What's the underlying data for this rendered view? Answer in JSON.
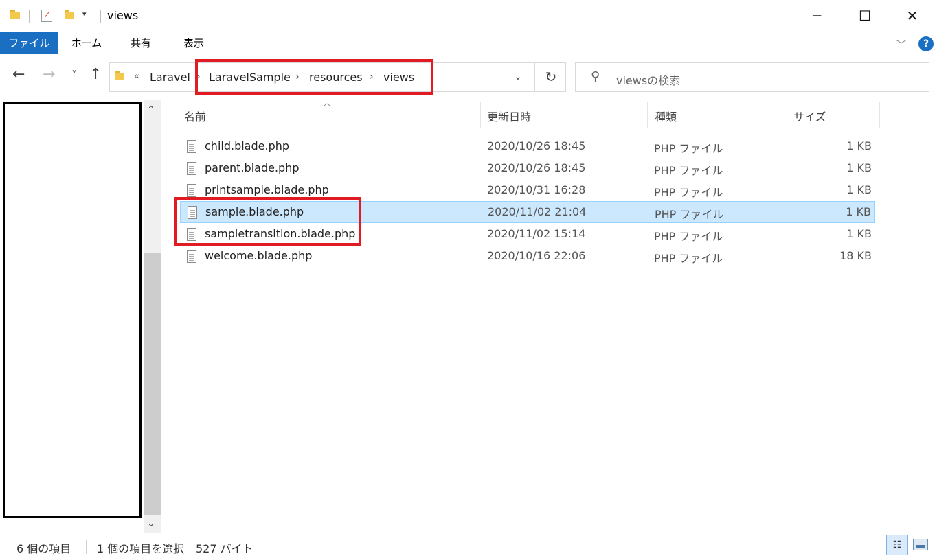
{
  "window": {
    "title": "views",
    "minimize_glyph": "─",
    "maximize_glyph": "☐",
    "close_glyph": "✕"
  },
  "quick_access": {
    "dropdown_glyph": "▾",
    "check_glyph": "✓"
  },
  "ribbon": {
    "tabs": [
      "ファイル",
      "ホーム",
      "共有",
      "表示"
    ],
    "expand_glyph": "﹀",
    "help_glyph": "?"
  },
  "nav": {
    "back_glyph": "←",
    "forward_glyph": "→",
    "recent_glyph": "˅",
    "up_glyph": "↑",
    "overflow_glyph": "«",
    "refresh_glyph": "↻",
    "dropdown_glyph": "⌄"
  },
  "breadcrumb": [
    "Laravel",
    "LaravelSample",
    "resources",
    "views"
  ],
  "search": {
    "placeholder": "viewsの検索",
    "icon_glyph": "⚲"
  },
  "columns": {
    "name": "名前",
    "modified": "更新日時",
    "type": "種類",
    "size": "サイズ"
  },
  "files": [
    {
      "name": "child.blade.php",
      "modified": "2020/10/26 18:45",
      "type": "PHP ファイル",
      "size": "1 KB"
    },
    {
      "name": "parent.blade.php",
      "modified": "2020/10/26 18:45",
      "type": "PHP ファイル",
      "size": "1 KB"
    },
    {
      "name": "printsample.blade.php",
      "modified": "2020/10/31 16:28",
      "type": "PHP ファイル",
      "size": "1 KB"
    },
    {
      "name": "sample.blade.php",
      "modified": "2020/11/02 21:04",
      "type": "PHP ファイル",
      "size": "1 KB"
    },
    {
      "name": "sampletransition.blade.php",
      "modified": "2020/11/02 15:14",
      "type": "PHP ファイル",
      "size": "1 KB"
    },
    {
      "name": "welcome.blade.php",
      "modified": "2020/10/16 22:06",
      "type": "PHP ファイル",
      "size": "18 KB"
    }
  ],
  "selected_file": "sample.blade.php",
  "status": {
    "item_count": "6 個の項目",
    "selection": "1 個の項目を選択",
    "selection_size": "527 バイト"
  },
  "scroll": {
    "up_glyph": "⌃",
    "down_glyph": "⌄"
  },
  "colors": {
    "accent": "#1a6fc2",
    "selection_bg": "#cce8ff",
    "annotation_red": "#e01b24"
  }
}
